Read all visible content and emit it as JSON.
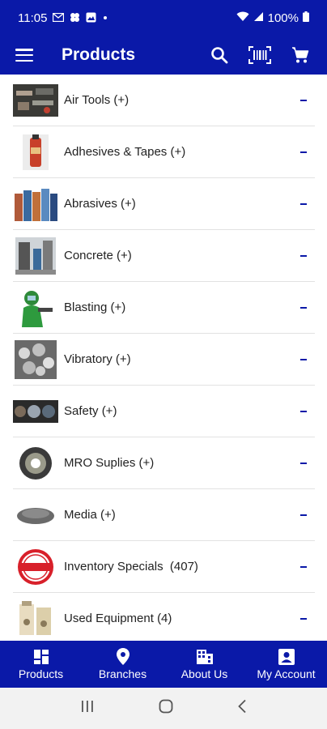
{
  "status_bar": {
    "time": "11:05",
    "battery": "100%"
  },
  "app_bar": {
    "title": "Products"
  },
  "categories": [
    {
      "label": "Air Tools (+)"
    },
    {
      "label": "Adhesives & Tapes (+)"
    },
    {
      "label": "Abrasives (+)"
    },
    {
      "label": "Concrete (+)"
    },
    {
      "label": "Blasting (+)"
    },
    {
      "label": "Vibratory (+)"
    },
    {
      "label": "Safety (+)"
    },
    {
      "label": "MRO Suplies (+)"
    },
    {
      "label": "Media (+)"
    },
    {
      "label": "Inventory Specials  (407)"
    },
    {
      "label": "Used Equipment (4)"
    }
  ],
  "bottom_nav": [
    {
      "label": "Products",
      "icon": "dashboard-icon"
    },
    {
      "label": "Branches",
      "icon": "location-pin-icon"
    },
    {
      "label": "About Us",
      "icon": "building-icon"
    },
    {
      "label": "My Account",
      "icon": "account-box-icon"
    }
  ],
  "colors": {
    "primary": "#0a19a8",
    "background": "#ffffff",
    "divider": "#e2e2e2",
    "system_nav": "#f2f2f2"
  }
}
